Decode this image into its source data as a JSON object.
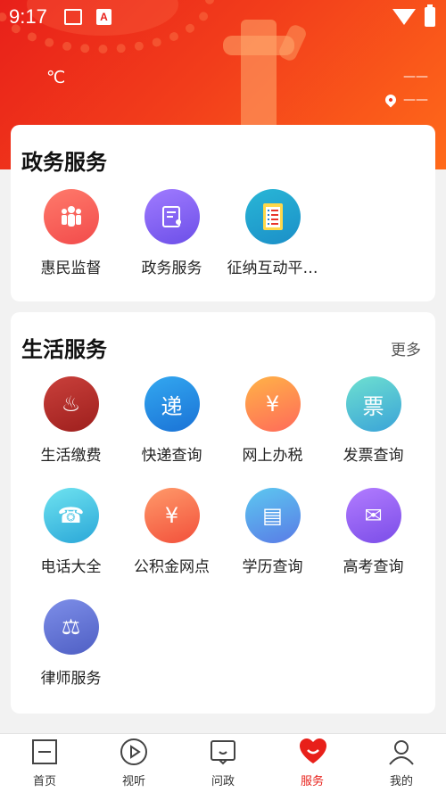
{
  "status_bar": {
    "time": "9:17",
    "notification_badge": "A"
  },
  "weather": {
    "temperature_unit": "℃",
    "dash_top": "——",
    "location_dash": "——"
  },
  "gov_services": {
    "title": "政务服务",
    "items": [
      {
        "label": "惠民监督",
        "icon": "people-icon",
        "color_from": "#ff7a6b",
        "color_to": "#f24b4b"
      },
      {
        "label": "政务服务",
        "icon": "document-icon",
        "color_from": "#a07bff",
        "color_to": "#6c4fe8"
      },
      {
        "label": "征纳互动平…",
        "icon": "checklist-icon",
        "color_from": "#29b6d6",
        "color_to": "#1b8fc8"
      }
    ]
  },
  "life_services": {
    "title": "生活服务",
    "more_label": "更多",
    "items": [
      {
        "label": "生活缴费",
        "icon": "fire-icon",
        "glyph": "♨",
        "color_from": "#c9403b",
        "color_to": "#9e1f1d"
      },
      {
        "label": "快递查询",
        "icon": "search-express-icon",
        "glyph": "递",
        "color_from": "#33a8f0",
        "color_to": "#1a72d6"
      },
      {
        "label": "网上办税",
        "icon": "ticket-icon",
        "glyph": "¥",
        "color_from": "#ffb347",
        "color_to": "#ff6a5a"
      },
      {
        "label": "发票查询",
        "icon": "search-invoice-icon",
        "glyph": "票",
        "color_from": "#6ee0d0",
        "color_to": "#3aa3d8"
      },
      {
        "label": "电话大全",
        "icon": "phone-book-icon",
        "glyph": "☎",
        "color_from": "#6fe3f0",
        "color_to": "#2aa7d8"
      },
      {
        "label": "公积金网点",
        "icon": "house-yen-icon",
        "glyph": "¥",
        "color_from": "#ff9a6a",
        "color_to": "#f2503b"
      },
      {
        "label": "学历查询",
        "icon": "id-card-icon",
        "glyph": "▤",
        "color_from": "#5cc8f0",
        "color_to": "#5a7be6"
      },
      {
        "label": "高考查询",
        "icon": "envelope-icon",
        "glyph": "✉",
        "color_from": "#b27cff",
        "color_to": "#7b4de8"
      },
      {
        "label": "律师服务",
        "icon": "scales-icon",
        "glyph": "⚖",
        "color_from": "#7d8ee8",
        "color_to": "#4f5fc4"
      }
    ]
  },
  "tabbar": {
    "tabs": [
      {
        "label": "首页",
        "icon": "home-icon"
      },
      {
        "label": "视听",
        "icon": "play-icon"
      },
      {
        "label": "问政",
        "icon": "chat-icon"
      },
      {
        "label": "服务",
        "icon": "heart-icon",
        "active": true
      },
      {
        "label": "我的",
        "icon": "profile-icon"
      }
    ],
    "active_color": "#e8201a"
  }
}
